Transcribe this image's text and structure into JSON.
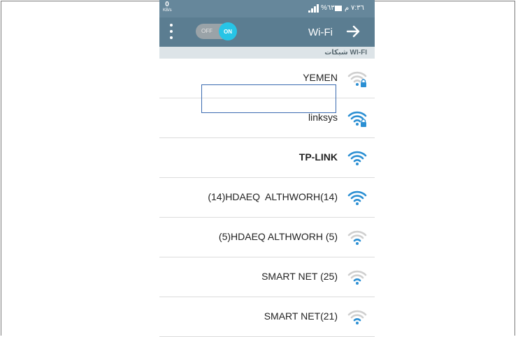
{
  "status_bar": {
    "speed_value": "0",
    "speed_unit": "KB/s",
    "battery_percent": "%٦٣",
    "time": "٧:٣٦ م"
  },
  "action_bar": {
    "toggle_off_label": "OFF",
    "toggle_on_label": "ON",
    "title": "Wi-Fi",
    "accent_color": "#27c4e6"
  },
  "section": {
    "title": "شبكات WI-FI"
  },
  "networks": [
    {
      "name": "YEMEN",
      "signal_icon": "wifi-locked-weak-icon",
      "locked": true
    },
    {
      "name": "linksys",
      "signal_icon": "wifi-locked-strong-icon",
      "locked": true
    },
    {
      "name": "TP-LINK",
      "signal_icon": "wifi-strong-icon",
      "locked": false
    },
    {
      "name": "(14)HDAEQ  ALTHWORH(14)",
      "signal_icon": "wifi-strong-icon",
      "locked": false
    },
    {
      "name": "(5)HDAEQ ALTHWORH (5)",
      "signal_icon": "wifi-weak-icon",
      "locked": false
    },
    {
      "name": "SMART NET (25)",
      "signal_icon": "wifi-weak-icon",
      "locked": false
    },
    {
      "name": "SMART NET(21)",
      "signal_icon": "wifi-weak-icon",
      "locked": false
    }
  ]
}
